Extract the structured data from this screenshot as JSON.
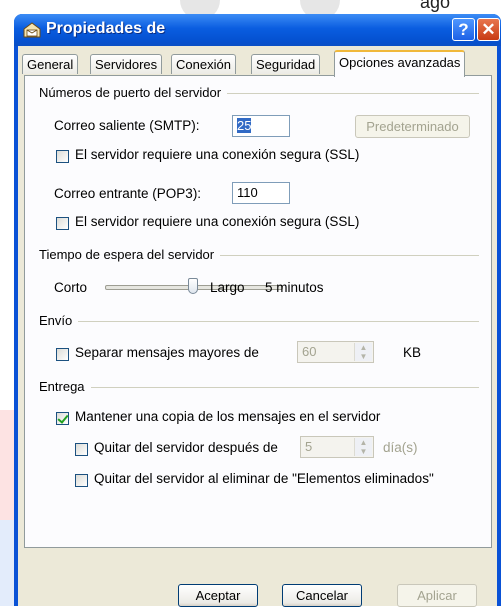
{
  "dialog": {
    "title": "Propiedades de",
    "help_label": "?",
    "close_label": "✕",
    "background_fragment": "ago"
  },
  "tabs": [
    {
      "label": "General"
    },
    {
      "label": "Servidores"
    },
    {
      "label": "Conexión"
    },
    {
      "label": "Seguridad"
    },
    {
      "label": "Opciones avanzadas",
      "active": true
    }
  ],
  "ports": {
    "group_title": "Números de puerto del servidor",
    "smtp_label": "Correo saliente (SMTP):",
    "smtp_value": "25",
    "default_button": "Predeterminado",
    "smtp_ssl_label": "El servidor requiere una conexión segura (SSL)",
    "smtp_ssl_checked": false,
    "pop3_label": "Correo entrante (POP3):",
    "pop3_value": "110",
    "pop3_ssl_label": "El servidor requiere una conexión segura (SSL)",
    "pop3_ssl_checked": false
  },
  "timeout": {
    "group_title": "Tiempo de espera del servidor",
    "short_label": "Corto",
    "long_label": "Largo",
    "value_text": "5 minutos",
    "level": 0.5
  },
  "send": {
    "group_title": "Envío",
    "split_label": "Separar mensajes mayores de",
    "split_checked": false,
    "split_value": "60",
    "split_unit": "KB"
  },
  "delivery": {
    "group_title": "Entrega",
    "keep_copy_label": "Mantener una copia de los mensajes en el servidor",
    "keep_copy_checked": true,
    "remove_after_label": "Quitar del servidor después de",
    "remove_after_checked": false,
    "remove_after_value": "5",
    "remove_after_unit": "día(s)",
    "remove_deleted_label": "Quitar del servidor al eliminar de \"Elementos eliminados\"",
    "remove_deleted_checked": false
  },
  "buttons": {
    "ok": "Aceptar",
    "cancel": "Cancelar",
    "apply": "Aplicar"
  },
  "colors": {
    "titlebar": "#0a5de0",
    "dialog_bg": "#ece9d8",
    "active_tab_accent": "#f0b83a",
    "selection": "#316ac5"
  }
}
